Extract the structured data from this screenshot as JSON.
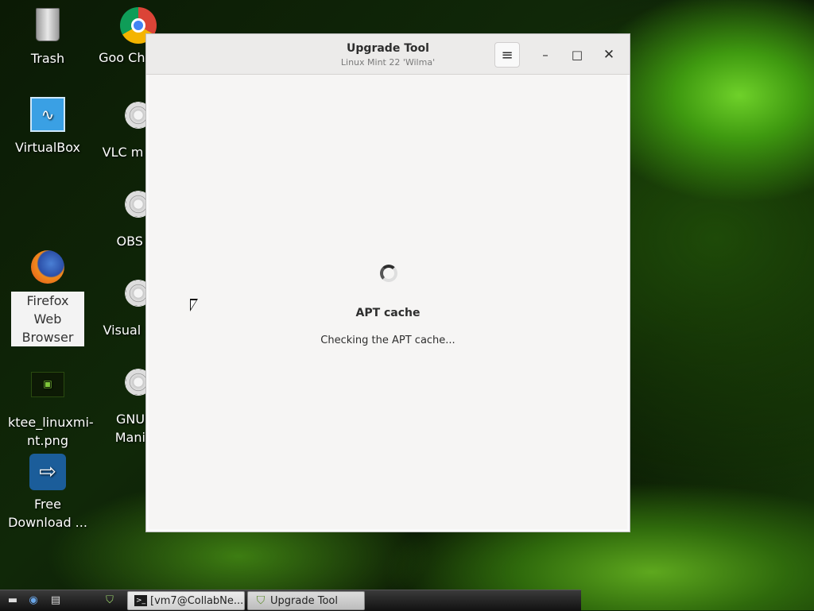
{
  "desktop": {
    "icons": [
      {
        "label": "Trash"
      },
      {
        "label": "VirtualBox"
      },
      {
        "label": "Firefox Web Browser"
      },
      {
        "label": "ktee_linuxmi-nt.png"
      },
      {
        "label": "Free Download ..."
      }
    ],
    "icons_col2": [
      {
        "label": "Goo Chrome"
      },
      {
        "label": "VLC m play"
      },
      {
        "label": "OBS St"
      },
      {
        "label": "Visual S Co"
      },
      {
        "label": "GNU In Manipu"
      }
    ]
  },
  "window": {
    "title": "Upgrade Tool",
    "subtitle": "Linux Mint 22 'Wilma'",
    "menu_icon": "≡",
    "minimize_icon": "–",
    "maximize_icon": "□",
    "close_icon": "✕"
  },
  "status": {
    "title": "APT cache",
    "message": "Checking the APT cache..."
  },
  "taskbar": {
    "tasks": [
      {
        "label": "[vm7@CollabNe..."
      },
      {
        "label": "Upgrade Tool"
      }
    ]
  }
}
